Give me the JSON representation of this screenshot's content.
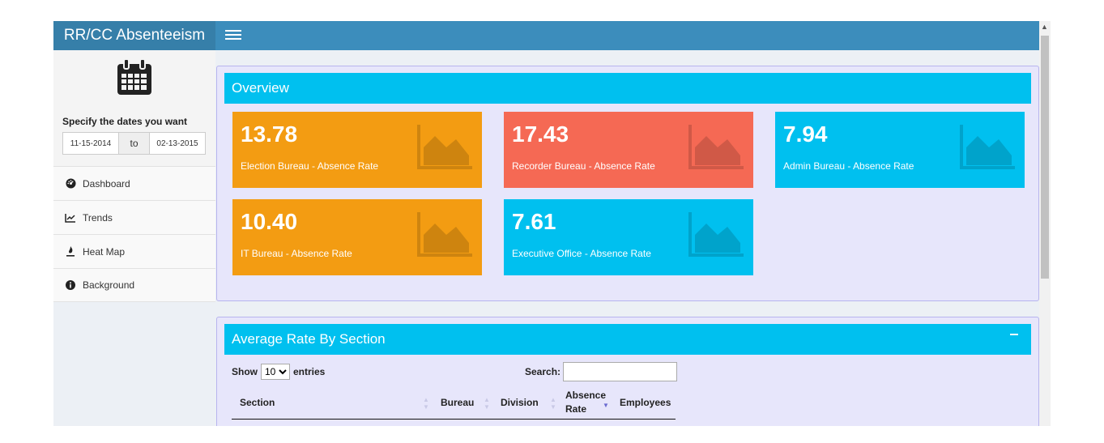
{
  "app": {
    "title": "RR/CC Absenteeism"
  },
  "sidebar": {
    "date_prompt": "Specify the dates you want",
    "date_from": "11-15-2014",
    "date_to_label": "to",
    "date_to": "02-13-2015",
    "items": [
      {
        "label": "Dashboard",
        "icon": "tachometer-icon"
      },
      {
        "label": "Trends",
        "icon": "line-chart-icon"
      },
      {
        "label": "Heat Map",
        "icon": "fire-icon"
      },
      {
        "label": "Background",
        "icon": "info-icon"
      }
    ]
  },
  "overview": {
    "title": "Overview",
    "tiles": [
      {
        "value": "13.78",
        "label": "Election Bureau - Absence Rate",
        "color": "#f39c12"
      },
      {
        "value": "17.43",
        "label": "Recorder Bureau - Absence Rate",
        "color": "#f56954"
      },
      {
        "value": "7.94",
        "label": "Admin Bureau - Absence Rate",
        "color": "#00c0ef"
      },
      {
        "value": "10.40",
        "label": "IT Bureau - Absence Rate",
        "color": "#f39c12"
      },
      {
        "value": "7.61",
        "label": "Executive Office - Absence Rate",
        "color": "#00c0ef"
      }
    ]
  },
  "section": {
    "title": "Average Rate By Section",
    "show_label": "Show",
    "entries_value": "10",
    "entries_label": "entries",
    "search_label": "Search:",
    "columns": [
      "Section",
      "Bureau",
      "Division",
      "Absence Rate",
      "Employees"
    ]
  },
  "colors": {
    "header": "#3c8dbc",
    "logo": "#367fa9",
    "accent": "#00c0ef",
    "orange": "#f39c12",
    "red": "#f56954"
  }
}
